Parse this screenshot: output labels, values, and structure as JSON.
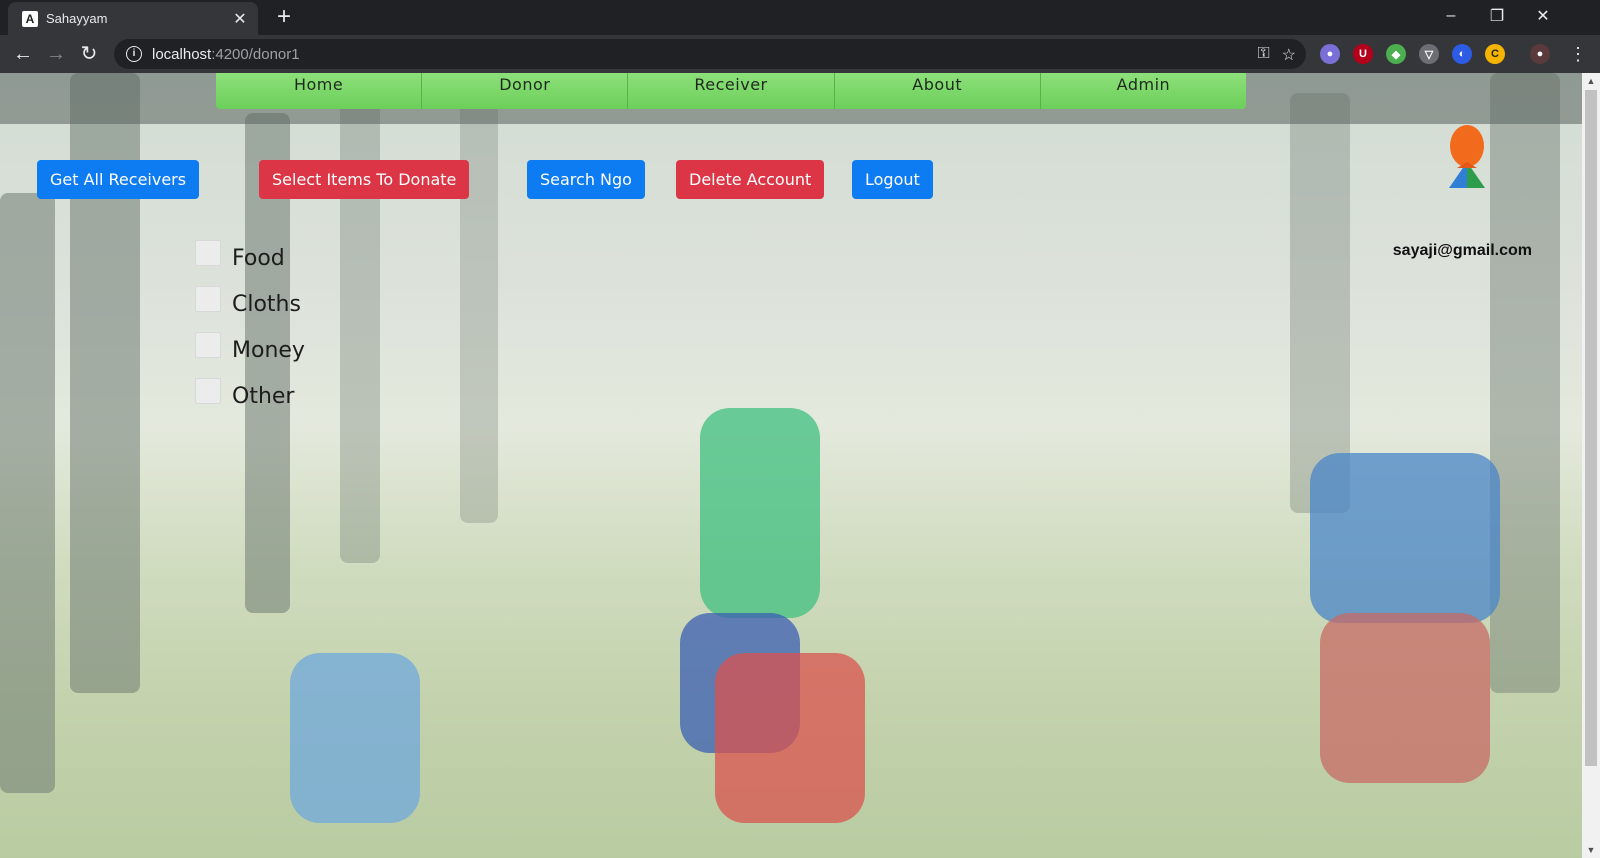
{
  "browser": {
    "tab_title": "Sahayyam",
    "favicon_letter": "A",
    "url_host": "localhost",
    "url_path": ":4200/donor1"
  },
  "nav": {
    "items": [
      {
        "label": "Home"
      },
      {
        "label": "Donor"
      },
      {
        "label": "Receiver"
      },
      {
        "label": "About"
      },
      {
        "label": "Admin"
      }
    ]
  },
  "actions": {
    "get_all_receivers": "Get All Receivers",
    "select_items": "Select Items To Donate",
    "search_ngo": "Search Ngo",
    "delete_account": "Delete Account",
    "logout": "Logout"
  },
  "user": {
    "email": "sayaji@gmail.com"
  },
  "donation_items": [
    {
      "label": "Food",
      "checked": false
    },
    {
      "label": "Cloths",
      "checked": false
    },
    {
      "label": "Money",
      "checked": false
    },
    {
      "label": "Other",
      "checked": false
    }
  ],
  "colors": {
    "primary_button": "#0d7cf2",
    "danger_button": "#dc3545",
    "nav_green": "#7ed86b"
  }
}
